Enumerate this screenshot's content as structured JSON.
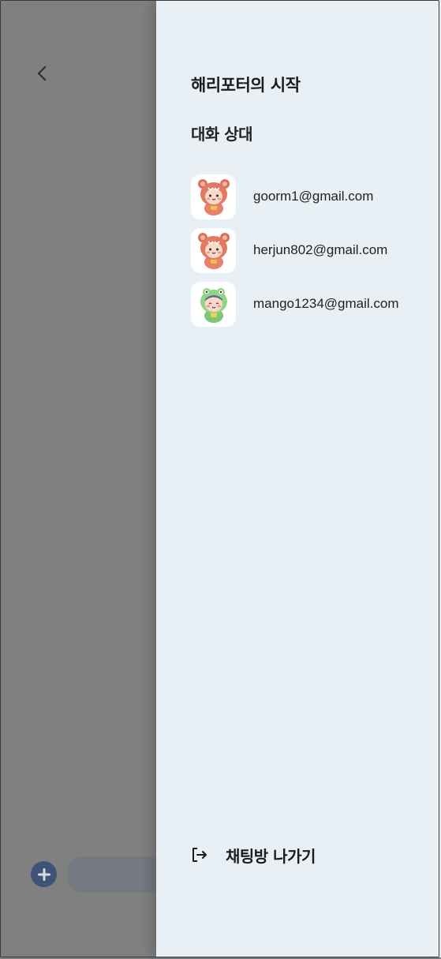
{
  "background": {
    "input_placeholder": ""
  },
  "drawer": {
    "room_title": "해리포터의 시작",
    "members_label": "대화 상대",
    "members": [
      {
        "email": "goorm1@gmail.com",
        "avatar": "bear-costume-avatar"
      },
      {
        "email": "herjun802@gmail.com",
        "avatar": "bear-costume-avatar"
      },
      {
        "email": "mango1234@gmail.com",
        "avatar": "frog-costume-avatar"
      }
    ],
    "leave_label": "채팅방 나가기"
  },
  "colors": {
    "overlay": "#808080",
    "drawer_bg": "#e8f0f5",
    "plus_button": "#3f5277"
  }
}
